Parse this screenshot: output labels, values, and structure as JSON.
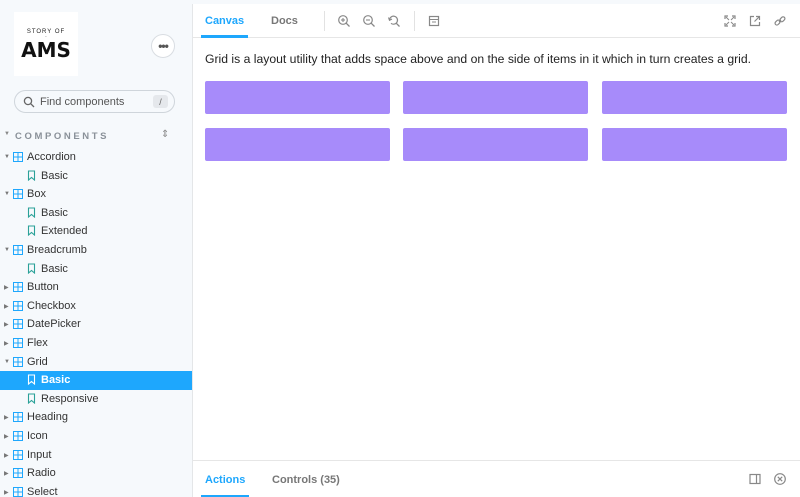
{
  "brand": {
    "logo_small": "Story of",
    "logo_main": "AMS"
  },
  "search": {
    "placeholder": "Find components",
    "shortcut": "/"
  },
  "sidebar": {
    "section_title": "COMPONENTS",
    "tree": [
      {
        "label": "Accordion",
        "type": "component",
        "expanded": true
      },
      {
        "label": "Basic",
        "type": "story"
      },
      {
        "label": "Box",
        "type": "component",
        "expanded": true
      },
      {
        "label": "Basic",
        "type": "story"
      },
      {
        "label": "Extended",
        "type": "story"
      },
      {
        "label": "Breadcrumb",
        "type": "component",
        "expanded": true
      },
      {
        "label": "Basic",
        "type": "story"
      },
      {
        "label": "Button",
        "type": "component",
        "expanded": false
      },
      {
        "label": "Checkbox",
        "type": "component",
        "expanded": false
      },
      {
        "label": "DatePicker",
        "type": "component",
        "expanded": false
      },
      {
        "label": "Flex",
        "type": "component",
        "expanded": false
      },
      {
        "label": "Grid",
        "type": "component",
        "expanded": true
      },
      {
        "label": "Basic",
        "type": "story",
        "active": true
      },
      {
        "label": "Responsive",
        "type": "story"
      },
      {
        "label": "Heading",
        "type": "component",
        "expanded": false
      },
      {
        "label": "Icon",
        "type": "component",
        "expanded": false
      },
      {
        "label": "Input",
        "type": "component",
        "expanded": false
      },
      {
        "label": "Radio",
        "type": "component",
        "expanded": false
      },
      {
        "label": "Select",
        "type": "component",
        "expanded": false
      }
    ]
  },
  "toolbar": {
    "tab_canvas": "Canvas",
    "tab_docs": "Docs",
    "icons": [
      "zoom-in-icon",
      "zoom-out-icon",
      "zoom-reset-icon",
      "background-icon",
      "fullscreen-icon",
      "open-new-tab-icon",
      "copy-link-icon"
    ]
  },
  "canvas": {
    "description": "Grid is a layout utility that adds space above and on the side of items in it which in turn creates a grid.",
    "grid_item_color": "#a78bfa",
    "grid_items": 6
  },
  "addons": {
    "tab_actions": "Actions",
    "tab_controls": "Controls (35)"
  },
  "colors": {
    "accent": "#1ea7fd",
    "sidebar_bg": "#f6f9fc"
  }
}
